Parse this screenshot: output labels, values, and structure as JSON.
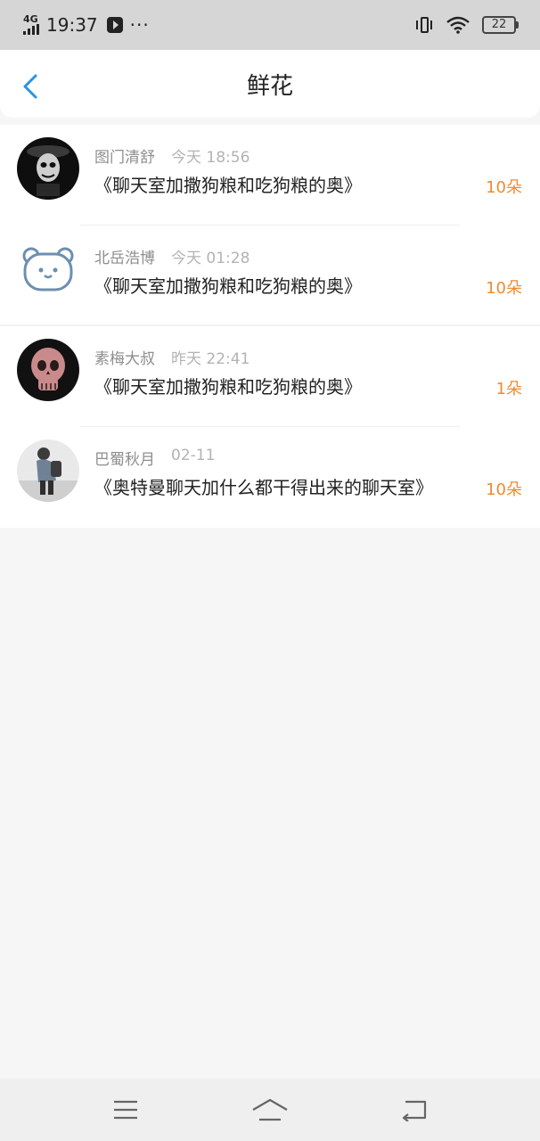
{
  "status_bar": {
    "network": "4G",
    "time": "19:37",
    "more": "···",
    "battery": "22",
    "icons": [
      "signal-icon",
      "media-player-icon",
      "vibrate-icon",
      "wifi-icon",
      "battery-icon"
    ]
  },
  "header": {
    "title": "鲜花",
    "back_icon": "chevron-left-icon"
  },
  "items": [
    {
      "user": "图门清舒",
      "time": "今天 18:56",
      "title": "《聊天室加撒狗粮和吃狗粮的奥》",
      "count": "10朵"
    },
    {
      "user": "北岳浩博",
      "time": "今天 01:28",
      "title": "《聊天室加撒狗粮和吃狗粮的奥》",
      "count": "10朵"
    },
    {
      "user": "素梅大叔",
      "time": "昨天 22:41",
      "title": "《聊天室加撒狗粮和吃狗粮的奥》",
      "count": "1朵"
    },
    {
      "user": "巴蜀秋月",
      "time": "02-11",
      "title": "《奥特曼聊天加什么都干得出来的聊天室》",
      "count": "10朵"
    }
  ],
  "colors": {
    "accent": "#2a93e0",
    "count": "#f08a2f",
    "status_bar_bg": "#d6d6d6",
    "page_bg": "#f7f6f6"
  },
  "bottom_nav": [
    "menu-icon",
    "home-icon",
    "back-icon"
  ]
}
